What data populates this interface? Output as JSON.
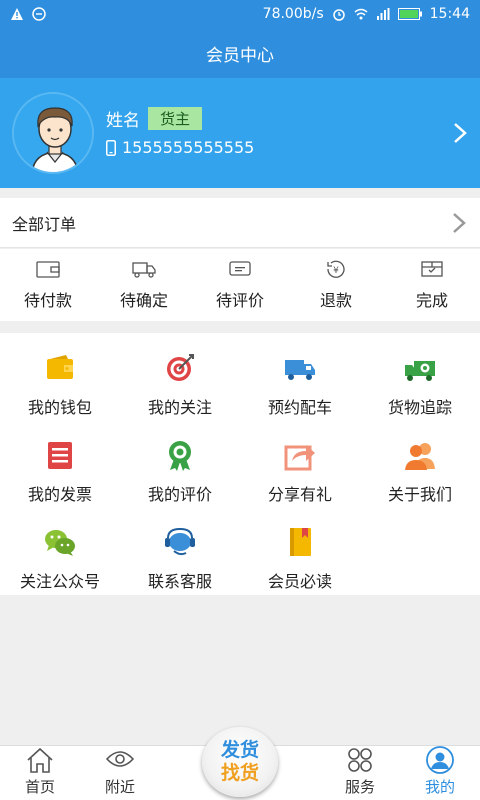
{
  "statusbar": {
    "speed": "78.00b/s",
    "time": "15:44"
  },
  "title": "会员中心",
  "profile": {
    "name": "姓名",
    "role": "货主",
    "phone": "1555555555555"
  },
  "orders": {
    "all_label": "全部订单",
    "items": [
      {
        "label": "待付款",
        "icon": "wallet-icon"
      },
      {
        "label": "待确定",
        "icon": "truck-icon"
      },
      {
        "label": "待评价",
        "icon": "comment-icon"
      },
      {
        "label": "退款",
        "icon": "refund-icon"
      },
      {
        "label": "完成",
        "icon": "box-icon"
      }
    ]
  },
  "services": [
    {
      "label": "我的钱包",
      "icon": "wallet-icon",
      "color": "#f5b800"
    },
    {
      "label": "我的关注",
      "icon": "target-icon",
      "color": "#e04545"
    },
    {
      "label": "预约配车",
      "icon": "truck-icon",
      "color": "#3a8fd8"
    },
    {
      "label": "货物追踪",
      "icon": "tracking-truck-icon",
      "color": "#3aa246"
    },
    {
      "label": "我的发票",
      "icon": "invoice-icon",
      "color": "#e04545"
    },
    {
      "label": "我的评价",
      "icon": "badge-icon",
      "color": "#3aa246"
    },
    {
      "label": "分享有礼",
      "icon": "share-icon",
      "color": "#f0937a"
    },
    {
      "label": "关于我们",
      "icon": "people-icon",
      "color": "#f07a30"
    },
    {
      "label": "关注公众号",
      "icon": "wechat-icon",
      "color": "#8ac234"
    },
    {
      "label": "联系客服",
      "icon": "headset-icon",
      "color": "#3a8fd8"
    },
    {
      "label": "会员必读",
      "icon": "book-icon",
      "color": "#f5b800"
    }
  ],
  "tabbar": {
    "home": "首页",
    "nearby": "附近",
    "center_line1": "发货",
    "center_line2": "找货",
    "service": "服务",
    "mine": "我的"
  },
  "colors": {
    "primary": "#2f8fde",
    "profile_bg": "#32a3ec",
    "role_badge": "#a8e6a1"
  }
}
